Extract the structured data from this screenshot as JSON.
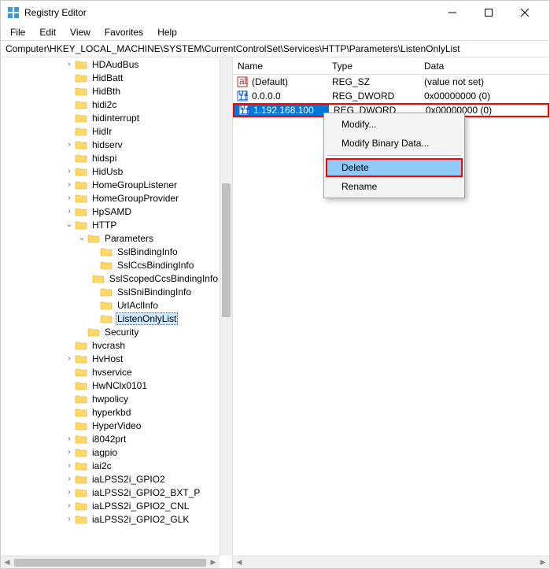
{
  "window": {
    "title": "Registry Editor"
  },
  "menu": {
    "file": "File",
    "edit": "Edit",
    "view": "View",
    "favorites": "Favorites",
    "help": "Help"
  },
  "address": "Computer\\HKEY_LOCAL_MACHINE\\SYSTEM\\CurrentControlSet\\Services\\HTTP\\Parameters\\ListenOnlyList",
  "tree": [
    {
      "depth": 5,
      "exp": ">",
      "label": "HDAudBus"
    },
    {
      "depth": 5,
      "exp": "",
      "label": "HidBatt"
    },
    {
      "depth": 5,
      "exp": "",
      "label": "HidBth"
    },
    {
      "depth": 5,
      "exp": "",
      "label": "hidi2c"
    },
    {
      "depth": 5,
      "exp": "",
      "label": "hidinterrupt"
    },
    {
      "depth": 5,
      "exp": "",
      "label": "HidIr"
    },
    {
      "depth": 5,
      "exp": ">",
      "label": "hidserv"
    },
    {
      "depth": 5,
      "exp": "",
      "label": "hidspi"
    },
    {
      "depth": 5,
      "exp": ">",
      "label": "HidUsb"
    },
    {
      "depth": 5,
      "exp": ">",
      "label": "HomeGroupListener"
    },
    {
      "depth": 5,
      "exp": ">",
      "label": "HomeGroupProvider"
    },
    {
      "depth": 5,
      "exp": ">",
      "label": "HpSAMD"
    },
    {
      "depth": 5,
      "exp": "v",
      "label": "HTTP"
    },
    {
      "depth": 6,
      "exp": "v",
      "label": "Parameters"
    },
    {
      "depth": 7,
      "exp": "",
      "label": "SslBindingInfo"
    },
    {
      "depth": 7,
      "exp": "",
      "label": "SslCcsBindingInfo"
    },
    {
      "depth": 7,
      "exp": "",
      "label": "SslScopedCcsBindingInfo"
    },
    {
      "depth": 7,
      "exp": "",
      "label": "SslSniBindingInfo"
    },
    {
      "depth": 7,
      "exp": "",
      "label": "UrlAclInfo"
    },
    {
      "depth": 7,
      "exp": "",
      "label": "ListenOnlyList",
      "selected": true
    },
    {
      "depth": 6,
      "exp": "",
      "label": "Security"
    },
    {
      "depth": 5,
      "exp": "",
      "label": "hvcrash"
    },
    {
      "depth": 5,
      "exp": ">",
      "label": "HvHost"
    },
    {
      "depth": 5,
      "exp": "",
      "label": "hvservice"
    },
    {
      "depth": 5,
      "exp": "",
      "label": "HwNClx0101"
    },
    {
      "depth": 5,
      "exp": "",
      "label": "hwpolicy"
    },
    {
      "depth": 5,
      "exp": "",
      "label": "hyperkbd"
    },
    {
      "depth": 5,
      "exp": "",
      "label": "HyperVideo"
    },
    {
      "depth": 5,
      "exp": ">",
      "label": "i8042prt"
    },
    {
      "depth": 5,
      "exp": ">",
      "label": "iagpio"
    },
    {
      "depth": 5,
      "exp": ">",
      "label": "iai2c"
    },
    {
      "depth": 5,
      "exp": ">",
      "label": "iaLPSS2i_GPIO2"
    },
    {
      "depth": 5,
      "exp": ">",
      "label": "iaLPSS2i_GPIO2_BXT_P"
    },
    {
      "depth": 5,
      "exp": ">",
      "label": "iaLPSS2i_GPIO2_CNL"
    },
    {
      "depth": 5,
      "exp": ">",
      "label": "iaLPSS2i_GPIO2_GLK"
    }
  ],
  "columns": {
    "name": "Name",
    "type": "Type",
    "data": "Data"
  },
  "values": [
    {
      "icon": "sz",
      "name": "(Default)",
      "type": "REG_SZ",
      "data": "(value not set)"
    },
    {
      "icon": "dw",
      "name": "0.0.0.0",
      "type": "REG_DWORD",
      "data": "0x00000000 (0)"
    },
    {
      "icon": "dw",
      "name": "1.192.168.100",
      "type": "REG_DWORD",
      "data": "0x00000000 (0)",
      "selected": true
    }
  ],
  "context": {
    "modify": "Modify...",
    "modify_binary": "Modify Binary Data...",
    "delete": "Delete",
    "rename": "Rename"
  }
}
